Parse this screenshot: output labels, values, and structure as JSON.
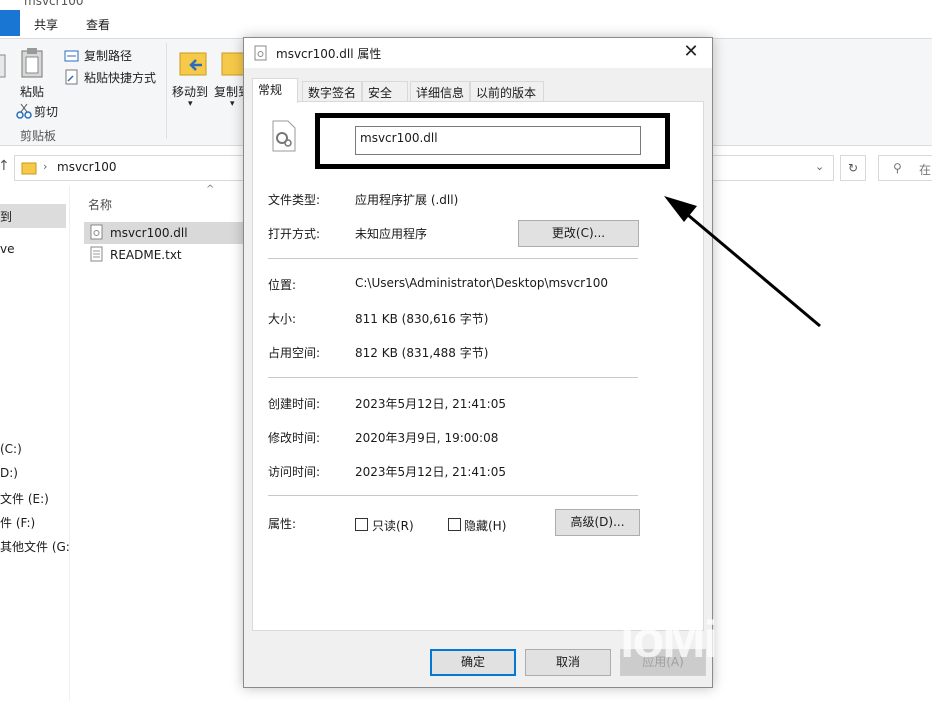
{
  "explorer": {
    "title_fragment": "msvcr100",
    "tabs": [
      "共享",
      "查看"
    ],
    "ribbon": {
      "copy_path": "复制路径",
      "paste_shortcut": "粘贴快捷方式",
      "paste": "粘贴",
      "cut": "剪切",
      "clipboard_group": "剪贴板",
      "move_to": "移动到",
      "copy_to": "复制到"
    },
    "address": {
      "folder": "msvcr100",
      "search_placeholder": "在"
    },
    "nav_items": [
      "到",
      "ve",
      "(C:)",
      "D:)",
      "文件 (E:)",
      "件 (F:)",
      "其他文件 (G:"
    ],
    "column_name": "名称",
    "files": [
      "msvcr100.dll",
      "README.txt"
    ]
  },
  "dialog": {
    "title": "msvcr100.dll 属性",
    "tabs": [
      "常规",
      "数字签名",
      "安全",
      "详细信息",
      "以前的版本"
    ],
    "filename": "msvcr100.dll",
    "rows": {
      "file_type_label": "文件类型:",
      "file_type_value": "应用程序扩展 (.dll)",
      "open_with_label": "打开方式:",
      "open_with_value": "未知应用程序",
      "change_button": "更改(C)...",
      "location_label": "位置:",
      "location_value": "C:\\Users\\Administrator\\Desktop\\msvcr100",
      "size_label": "大小:",
      "size_value": "811 KB (830,616 字节)",
      "disk_size_label": "占用空间:",
      "disk_size_value": "812 KB (831,488 字节)",
      "created_label": "创建时间:",
      "created_value": "2023年5月12日, 21:41:05",
      "modified_label": "修改时间:",
      "modified_value": "2020年3月9日, 19:00:08",
      "accessed_label": "访问时间:",
      "accessed_value": "2023年5月12日, 21:41:05",
      "attributes_label": "属性:",
      "readonly_label": "只读(R)",
      "hidden_label": "隐藏(H)",
      "advanced_button": "高级(D)..."
    },
    "buttons": {
      "ok": "确定",
      "cancel": "取消",
      "apply": "应用(A)"
    }
  },
  "overlay": {
    "watermark": "ioMi"
  },
  "colors": {
    "accent": "#0078d7",
    "highlight": "#000000"
  }
}
